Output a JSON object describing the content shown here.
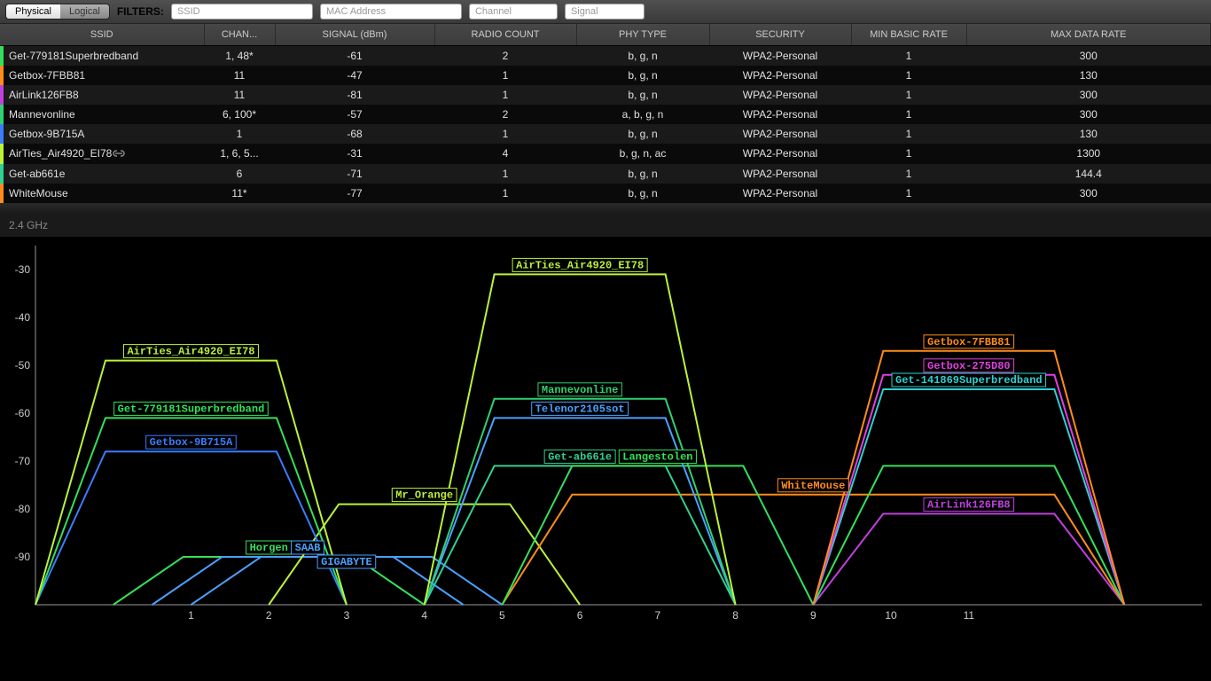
{
  "toolbar": {
    "tab_physical": "Physical",
    "tab_logical": "Logical",
    "filters_label": "FILTERS:",
    "ph_ssid": "SSID",
    "ph_mac": "MAC Address",
    "ph_channel": "Channel",
    "ph_signal": "Signal"
  },
  "columns": [
    "SSID",
    "CHAN...",
    "SIGNAL (dBm)",
    "RADIO COUNT",
    "PHY TYPE",
    "SECURITY",
    "MIN BASIC RATE",
    "MAX DATA RATE"
  ],
  "rows": [
    {
      "ssid": "Get-779181Superbredband",
      "chan": "1, 48*",
      "sig": "-61",
      "rc": "2",
      "phy": "b, g, n",
      "sec": "WPA2-Personal",
      "min": "1",
      "max": "300",
      "color": "#34e05a"
    },
    {
      "ssid": "Getbox-7FBB81",
      "chan": "11",
      "sig": "-47",
      "rc": "1",
      "phy": "b, g, n",
      "sec": "WPA2-Personal",
      "min": "1",
      "max": "130",
      "color": "#ff8c1a"
    },
    {
      "ssid": "AirLink126FB8",
      "chan": "11",
      "sig": "-81",
      "rc": "1",
      "phy": "b, g, n",
      "sec": "WPA2-Personal",
      "min": "1",
      "max": "300",
      "color": "#c040e0"
    },
    {
      "ssid": "Mannevonline",
      "chan": "6, 100*",
      "sig": "-57",
      "rc": "2",
      "phy": "a, b, g, n",
      "sec": "WPA2-Personal",
      "min": "1",
      "max": "300",
      "color": "#30d070"
    },
    {
      "ssid": "Getbox-9B715A",
      "chan": "1",
      "sig": "-68",
      "rc": "1",
      "phy": "b, g, n",
      "sec": "WPA2-Personal",
      "min": "1",
      "max": "130",
      "color": "#3a7dff"
    },
    {
      "ssid": "AirTies_Air4920_EI78",
      "chan": "1, 6, 5...",
      "sig": "-31",
      "rc": "4",
      "phy": "b, g, n, ac",
      "sec": "WPA2-Personal",
      "min": "1",
      "max": "1300",
      "color": "#baf23a",
      "link": true
    },
    {
      "ssid": "Get-ab661e",
      "chan": "6",
      "sig": "-71",
      "rc": "1",
      "phy": "b, g, n",
      "sec": "WPA2-Personal",
      "min": "1",
      "max": "144.4",
      "color": "#30d090"
    },
    {
      "ssid": "WhiteMouse",
      "chan": "11*",
      "sig": "-77",
      "rc": "1",
      "phy": "b, g, n",
      "sec": "WPA2-Personal",
      "min": "1",
      "max": "300",
      "color": "#ff8c1a"
    }
  ],
  "band_label": "2.4 GHz",
  "chart_data": {
    "type": "line",
    "title": "",
    "xlabel": "",
    "ylabel": "",
    "ylim": [
      -100,
      -25
    ],
    "yticks": [
      -30,
      -40,
      -50,
      -60,
      -70,
      -80,
      -90
    ],
    "xticks": [
      1,
      2,
      3,
      4,
      5,
      6,
      7,
      8,
      9,
      10,
      11
    ],
    "series": [
      {
        "name": "AirTies_Air4920_EI78",
        "channel": 1,
        "signal": -49,
        "width": 4,
        "color": "#baf23a"
      },
      {
        "name": "Get-779181Superbredband",
        "channel": 1,
        "signal": -61,
        "width": 4,
        "color": "#34e05a"
      },
      {
        "name": "Getbox-9B715A",
        "channel": 1,
        "signal": -68,
        "width": 4,
        "color": "#3a7dff"
      },
      {
        "name": "Horgen",
        "channel": 2,
        "signal": -90,
        "width": 4,
        "color": "#34e05a"
      },
      {
        "name": "SAAB",
        "channel": 2.5,
        "signal": -90,
        "width": 4,
        "color": "#4aa0ff"
      },
      {
        "name": "GIGABYTE",
        "channel": 3,
        "signal": -90,
        "width": 4,
        "color": "#4aa0ff"
      },
      {
        "name": "Mr_Orange",
        "channel": 4,
        "signal": -79,
        "width": 4,
        "color": "#baf23a"
      },
      {
        "name": "AirTies_Air4920_EI78",
        "channel": 6,
        "signal": -31,
        "width": 4,
        "color": "#baf23a",
        "label_pos": "top"
      },
      {
        "name": "Mannevonline",
        "channel": 6,
        "signal": -57,
        "width": 4,
        "color": "#30d070"
      },
      {
        "name": "Telenor2105sot",
        "channel": 6,
        "signal": -61,
        "width": 4,
        "color": "#4aa0ff"
      },
      {
        "name": "Get-ab661e",
        "channel": 6,
        "signal": -71,
        "width": 4,
        "color": "#30d090"
      },
      {
        "name": "Langestolen",
        "channel": 7,
        "signal": -71,
        "width": 4,
        "color": "#34e05a"
      },
      {
        "name": "WhiteMouse",
        "channel": 9,
        "signal": -77,
        "width": 8,
        "color": "#ff8c1a"
      },
      {
        "name": "Getbox-7FBB81",
        "channel": 11,
        "signal": -47,
        "width": 4,
        "color": "#ff8c1a"
      },
      {
        "name": "Getbox-275D80",
        "channel": 11,
        "signal": -52,
        "width": 4,
        "color": "#e040e0"
      },
      {
        "name": "Get-141869Superbredband",
        "channel": 11,
        "signal": -55,
        "width": 4,
        "color": "#30d0d0"
      },
      {
        "name": "AirLink126FB8",
        "channel": 11,
        "signal": -81,
        "width": 4,
        "color": "#c040e0"
      },
      {
        "name": "",
        "channel": 11,
        "signal": -71,
        "width": 4,
        "color": "#34e05a",
        "nolabel": true
      }
    ]
  }
}
